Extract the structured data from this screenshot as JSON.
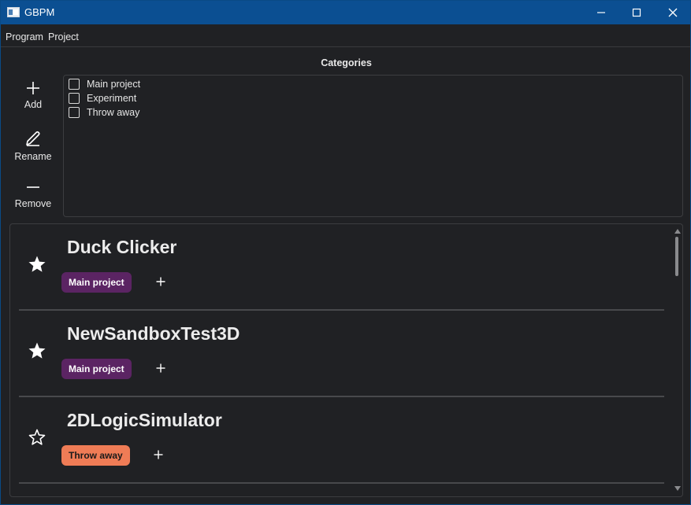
{
  "window": {
    "title": "GBPM",
    "controls": [
      "minimize-icon",
      "maximize-icon",
      "close-icon"
    ]
  },
  "menu": {
    "program": "Program",
    "project": "Project"
  },
  "categories": {
    "header": "Categories",
    "tools": {
      "add": "Add",
      "rename": "Rename",
      "remove": "Remove"
    },
    "items": [
      {
        "label": "Main project",
        "checked": false
      },
      {
        "label": "Experiment",
        "checked": false
      },
      {
        "label": "Throw away",
        "checked": false
      }
    ]
  },
  "projects": [
    {
      "name": "Duck Clicker",
      "favorite": true,
      "tag": "Main project",
      "tag_color": "#5b2463"
    },
    {
      "name": "NewSandboxTest3D",
      "favorite": true,
      "tag": "Main project",
      "tag_color": "#5b2463"
    },
    {
      "name": "2DLogicSimulator",
      "favorite": false,
      "tag": "Throw away",
      "tag_color": "#ef7c56"
    }
  ],
  "colors": {
    "titlebar": "#0b4f92",
    "background": "#202124",
    "main_project_tag": "#5b2463",
    "throw_away_tag": "#ef7c56"
  }
}
